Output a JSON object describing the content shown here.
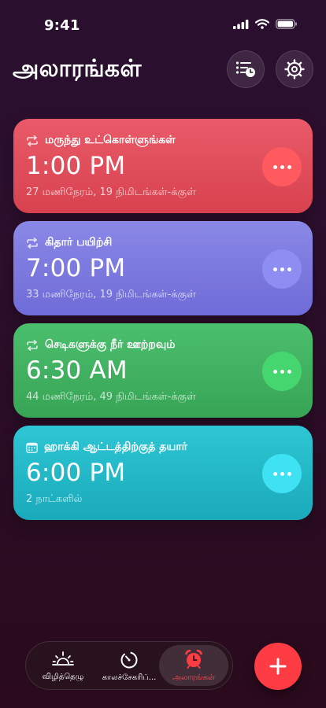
{
  "status_bar": {
    "time": "9:41"
  },
  "header": {
    "title": "அலாரங்கள்"
  },
  "alarms": [
    {
      "label": "மருந்து உட்கொள்ளுங்கள்",
      "time": "1:00 PM",
      "remaining": "27 மணிநேரம், 19 நிமிடங்கள்-க்குள்",
      "icon": "repeat-icon",
      "color": "#e04e5b"
    },
    {
      "label": "கிதார் பயிற்சி",
      "time": "7:00 PM",
      "remaining": "33 மணிநேரம், 19 நிமிடங்கள்-க்குள்",
      "icon": "repeat-icon",
      "color": "#7c79df"
    },
    {
      "label": "செடிகளுக்கு நீர் ஊற்றவும்",
      "time": "6:30 AM",
      "remaining": "44 மணிநேரம், 49 நிமிடங்கள்-க்குள்",
      "icon": "repeat-icon",
      "color": "#3fb262"
    },
    {
      "label": "ஹாக்கி ஆட்டத்திற்குத் தயார்",
      "time": "6:00 PM",
      "remaining": "2 நாட்களில்",
      "icon": "calendar-icon",
      "color": "#24b9c8"
    }
  ],
  "tabs": [
    {
      "label": "விழித்தெழு",
      "icon": "sunrise-icon"
    },
    {
      "label": "காலச்சேகரிப்...",
      "icon": "timer-icon"
    },
    {
      "label": "அலாரங்கள்",
      "icon": "alarm-clock-icon",
      "active": true
    }
  ],
  "colors": {
    "accent": "#ff3b43"
  }
}
